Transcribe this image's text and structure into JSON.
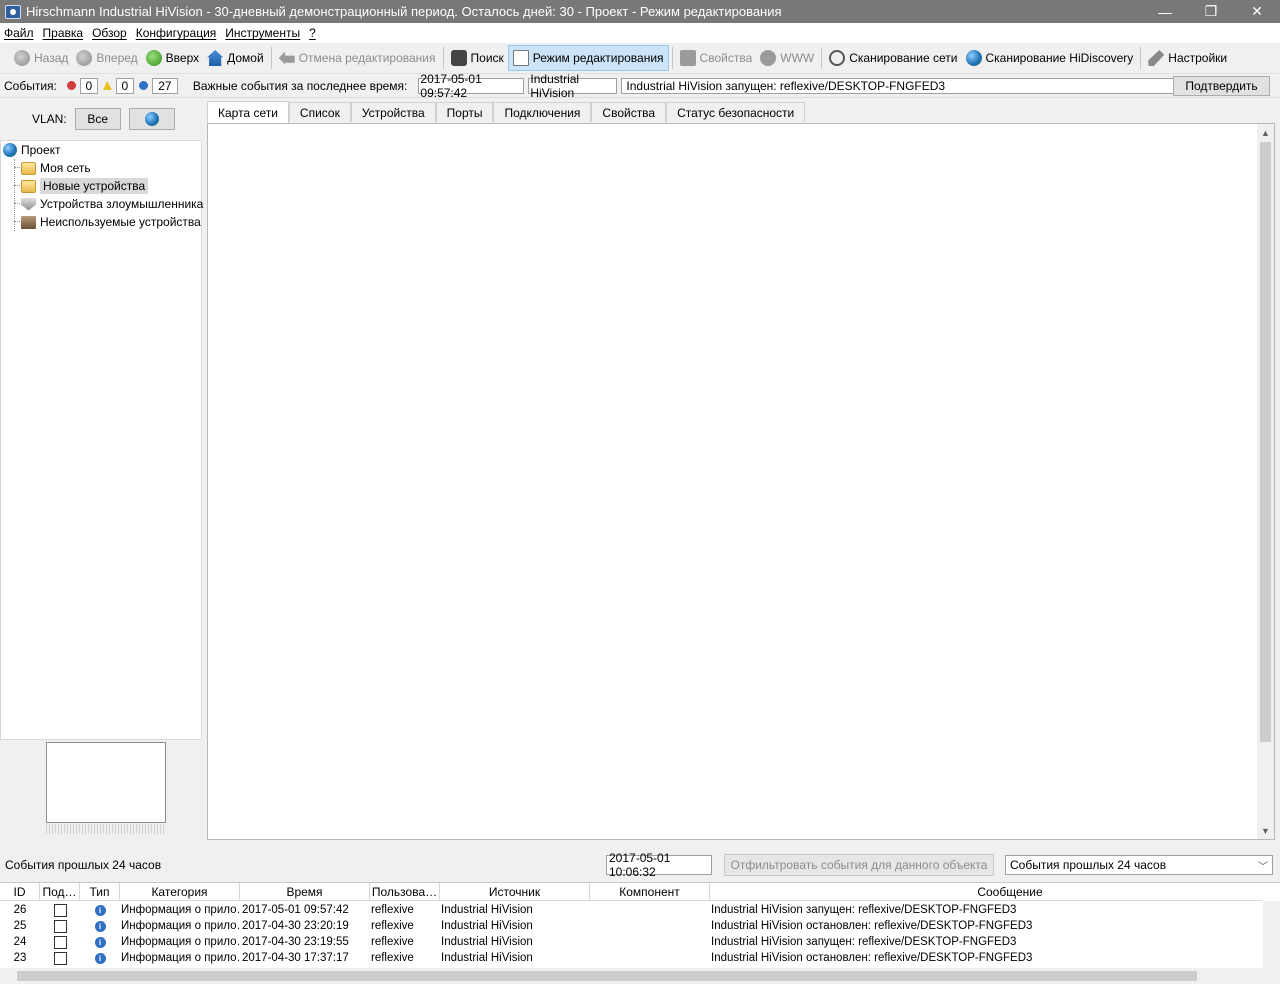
{
  "window": {
    "title": "Hirschmann Industrial HiVision - 30-дневный демонстрационный период. Осталось дней: 30 - Проект - Режим редактирования",
    "minimize": "—",
    "restore": "❐",
    "close": "✕"
  },
  "menu": [
    "Файл",
    "Правка",
    "Обзор",
    "Конфигурация",
    "Инструменты",
    "?"
  ],
  "toolbar": {
    "back": "Назад",
    "forward": "Вперед",
    "up": "Вверх",
    "home": "Домой",
    "undo_edit": "Отмена редактирования",
    "search": "Поиск",
    "edit_mode": "Режим редактирования",
    "properties": "Свойства",
    "www": "WWW",
    "network_scan": "Сканирование сети",
    "hidiscovery_scan": "Сканирование HiDiscovery",
    "settings": "Настройки"
  },
  "events_bar": {
    "label": "События:",
    "errors": "0",
    "warnings": "0",
    "infos": "27",
    "important_label": "Важные события за последнее время:",
    "last_time": "2017-05-01 09:57:42",
    "last_source": "Industrial HiVision",
    "last_message": "Industrial HiVision запущен: reflexive/DESKTOP-FNGFED3",
    "confirm": "Подтвердить"
  },
  "vlan": {
    "label": "VLAN:",
    "all_button": "Все"
  },
  "tree": {
    "root": "Проект",
    "items": [
      "Моя сеть",
      "Новые устройства",
      "Устройства злоумышленника",
      "Неиспользуемые устройства"
    ]
  },
  "tabs": [
    "Карта сети",
    "Список",
    "Устройства",
    "Порты",
    "Подключения",
    "Свойства",
    "Статус безопасности"
  ],
  "events_panel": {
    "title": "События прошлых 24 часов",
    "time": "2017-05-01 10:06:32",
    "filter_button": "Отфильтровать события для данного объекта",
    "range_select": "События прошлых 24 часов"
  },
  "event_table": {
    "columns": [
      "ID",
      "Под…",
      "Тип",
      "Категория",
      "Время",
      "Пользова…",
      "Источник",
      "Компонент",
      "Сообщение"
    ],
    "rows": [
      {
        "id": "26",
        "category": "Информация о прило…",
        "time": "2017-05-01 09:57:42",
        "user": "reflexive",
        "source": "Industrial HiVision",
        "component": "",
        "message": "Industrial HiVision запущен: reflexive/DESKTOP-FNGFED3"
      },
      {
        "id": "25",
        "category": "Информация о прило…",
        "time": "2017-04-30 23:20:19",
        "user": "reflexive",
        "source": "Industrial HiVision",
        "component": "",
        "message": "Industrial HiVision остановлен: reflexive/DESKTOP-FNGFED3"
      },
      {
        "id": "24",
        "category": "Информация о прило…",
        "time": "2017-04-30 23:19:55",
        "user": "reflexive",
        "source": "Industrial HiVision",
        "component": "",
        "message": "Industrial HiVision запущен: reflexive/DESKTOP-FNGFED3"
      },
      {
        "id": "23",
        "category": "Информация о прило…",
        "time": "2017-04-30 17:37:17",
        "user": "reflexive",
        "source": "Industrial HiVision",
        "component": "",
        "message": "Industrial HiVision остановлен: reflexive/DESKTOP-FNGFED3"
      }
    ]
  },
  "colors": {
    "titlebar": "#787878",
    "active_tool": "#cce4f7",
    "info": "#2f6fc4",
    "error": "#d23c3c",
    "warning": "#e8c21a"
  }
}
